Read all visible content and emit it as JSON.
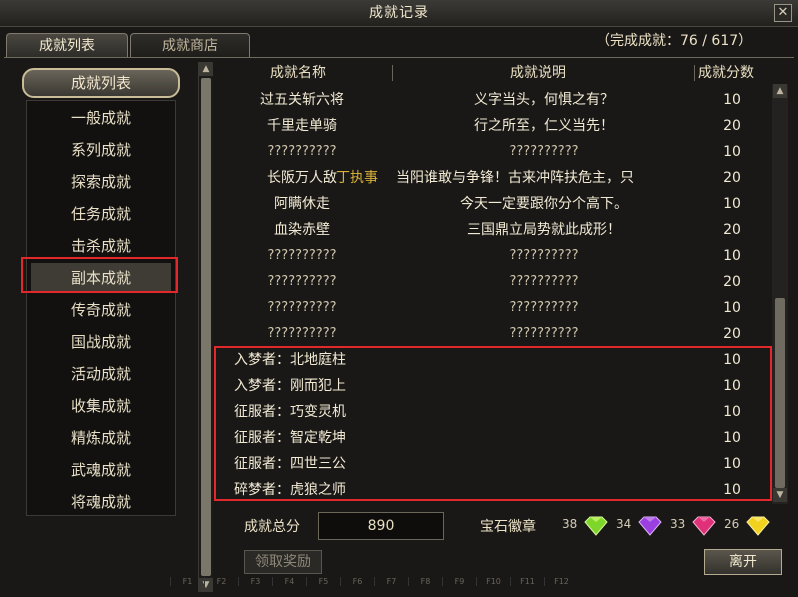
{
  "window": {
    "title": "成就记录",
    "close_label": "✕"
  },
  "tabs": [
    {
      "label": "成就列表",
      "active": true
    },
    {
      "label": "成就商店",
      "active": false
    }
  ],
  "progress": "（完成成就：76 / 617）",
  "sidebar": {
    "header": "成就列表",
    "items": [
      {
        "label": "一般成就"
      },
      {
        "label": "系列成就"
      },
      {
        "label": "探索成就"
      },
      {
        "label": "任务成就"
      },
      {
        "label": "击杀成就"
      },
      {
        "label": "副本成就",
        "selected": true
      },
      {
        "label": "传奇成就"
      },
      {
        "label": "国战成就"
      },
      {
        "label": "活动成就"
      },
      {
        "label": "收集成就"
      },
      {
        "label": "精炼成就"
      },
      {
        "label": "武魂成就"
      },
      {
        "label": "将魂成就"
      }
    ]
  },
  "table": {
    "headers": {
      "name": "成就名称",
      "desc": "成就说明",
      "score": "成就分数"
    },
    "rows": [
      {
        "name": "过五关斩六将",
        "desc": "义字当头，何惧之有？",
        "score": "10"
      },
      {
        "name": "千里走单骑",
        "desc": "行之所至，仁义当先！",
        "score": "20"
      },
      {
        "name": "??????????",
        "desc": "??????????",
        "score": "10"
      },
      {
        "name": "长阪万人敌",
        "desc": "当阳谁敢与争锋！古来冲阵扶危主，只",
        "overlay": "丁执事",
        "score": "20"
      },
      {
        "name": "阿瞒休走",
        "desc": "今天一定要跟你分个高下。",
        "score": "10"
      },
      {
        "name": "血染赤壁",
        "desc": "三国鼎立局势就此成形！",
        "score": "20"
      },
      {
        "name": "??????????",
        "desc": "??????????",
        "score": "10"
      },
      {
        "name": "??????????",
        "desc": "??????????",
        "score": "20"
      },
      {
        "name": "??????????",
        "desc": "??????????",
        "score": "10"
      },
      {
        "name": "??????????",
        "desc": "??????????",
        "score": "20"
      },
      {
        "name": "入梦者：北地庭柱",
        "desc": "",
        "score": "10"
      },
      {
        "name": "入梦者：刚而犯上",
        "desc": "",
        "score": "10"
      },
      {
        "name": "征服者：巧变灵机",
        "desc": "",
        "score": "10"
      },
      {
        "name": "征服者：智定乾坤",
        "desc": "",
        "score": "10"
      },
      {
        "name": "征服者：四世三公",
        "desc": "",
        "score": "10"
      },
      {
        "name": "碎梦者：虎狼之师",
        "desc": "",
        "score": "10"
      }
    ]
  },
  "footer": {
    "total_label": "成就总分",
    "total_value": "890",
    "badge_label": "宝石徽章",
    "gems": [
      {
        "count": "38",
        "color": "#7fd62a",
        "icon": "green-gem-icon"
      },
      {
        "count": "34",
        "color": "#9b3fe0",
        "icon": "purple-gem-icon"
      },
      {
        "count": "33",
        "color": "#e0307a",
        "icon": "red-gem-icon"
      },
      {
        "count": "26",
        "color": "#f2d21e",
        "icon": "yellow-gem-icon"
      }
    ],
    "claim_label": "领取奖励",
    "leave_label": "离开"
  },
  "fkeys": [
    "F1",
    "F2",
    "F3",
    "F4",
    "F5",
    "F6",
    "F7",
    "F8",
    "F9",
    "F10",
    "F11",
    "F12"
  ]
}
